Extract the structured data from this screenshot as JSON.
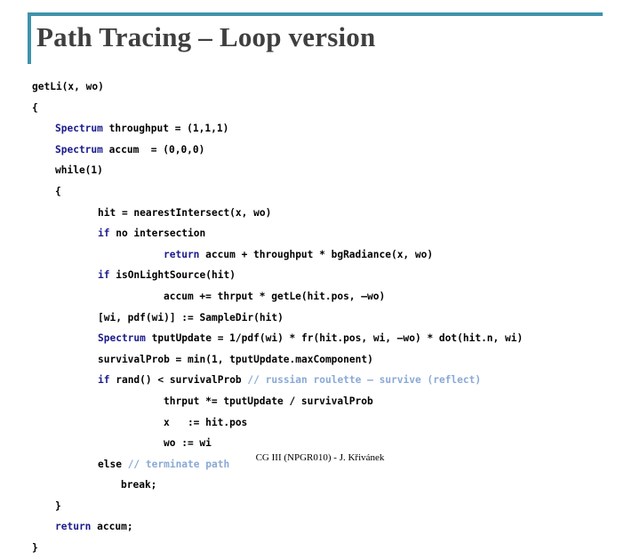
{
  "slide": {
    "accent_color": "#3f93ac",
    "title": "Path Tracing – Loop version",
    "footer": "CG III (NPGR010) - J. Křivánek"
  },
  "code": {
    "language": "pseudocode",
    "keyword_color": "#1a1a8c",
    "comment_color": "#8aa9d6",
    "text_color": "#000000",
    "lines": [
      {
        "indent": 0,
        "segments": [
          {
            "kind": "plain",
            "text": "getLi(x, wo)"
          }
        ]
      },
      {
        "indent": 0,
        "segments": [
          {
            "kind": "plain",
            "text": "{"
          }
        ]
      },
      {
        "indent": 1,
        "segments": [
          {
            "kind": "kw",
            "text": "Spectrum"
          },
          {
            "kind": "plain",
            "text": " throughput = (1,1,1)"
          }
        ]
      },
      {
        "indent": 1,
        "segments": [
          {
            "kind": "kw",
            "text": "Spectrum"
          },
          {
            "kind": "plain",
            "text": " accum  = (0,0,0)"
          }
        ]
      },
      {
        "indent": 1,
        "segments": [
          {
            "kind": "plain",
            "text": "while(1)"
          }
        ]
      },
      {
        "indent": 1,
        "segments": [
          {
            "kind": "plain",
            "text": "{"
          }
        ]
      },
      {
        "indent": 2,
        "segments": [
          {
            "kind": "plain",
            "text": "hit = nearestIntersect(x, wo)"
          }
        ]
      },
      {
        "indent": 2,
        "segments": [
          {
            "kind": "kw",
            "text": "if"
          },
          {
            "kind": "plain",
            "text": " no intersection"
          }
        ]
      },
      {
        "indent": 4,
        "segments": [
          {
            "kind": "kw",
            "text": "return"
          },
          {
            "kind": "plain",
            "text": " accum + throughput * bgRadiance(x, wo)"
          }
        ]
      },
      {
        "indent": 2,
        "segments": [
          {
            "kind": "kw",
            "text": "if"
          },
          {
            "kind": "plain",
            "text": " isOnLightSource(hit)"
          }
        ]
      },
      {
        "indent": 4,
        "segments": [
          {
            "kind": "plain",
            "text": "accum += thrput * getLe(hit.pos, –wo)"
          }
        ]
      },
      {
        "indent": 2,
        "segments": [
          {
            "kind": "plain",
            "text": "[wi, pdf(wi)] := SampleDir(hit)"
          }
        ]
      },
      {
        "indent": 2,
        "segments": [
          {
            "kind": "kw",
            "text": "Spectrum"
          },
          {
            "kind": "plain",
            "text": " tputUpdate = 1/pdf(wi) * fr(hit.pos, wi, –wo) * dot(hit.n, wi)"
          }
        ]
      },
      {
        "indent": 2,
        "segments": [
          {
            "kind": "plain",
            "text": "survivalProb = min(1, tputUpdate.maxComponent)"
          }
        ]
      },
      {
        "indent": 2,
        "segments": [
          {
            "kind": "kw",
            "text": "if"
          },
          {
            "kind": "plain",
            "text": " rand() < survivalProb "
          },
          {
            "kind": "comment",
            "text": "// russian roulette – survive (reflect)"
          }
        ]
      },
      {
        "indent": 4,
        "segments": [
          {
            "kind": "plain",
            "text": "thrput *= tputUpdate / survivalProb"
          }
        ]
      },
      {
        "indent": 4,
        "segments": [
          {
            "kind": "plain",
            "text": "x   := hit.pos"
          }
        ]
      },
      {
        "indent": 4,
        "segments": [
          {
            "kind": "plain",
            "text": "wo := wi"
          }
        ]
      },
      {
        "indent": 2,
        "segments": [
          {
            "kind": "plain",
            "text": "else "
          },
          {
            "kind": "comment",
            "text": "// terminate path"
          }
        ]
      },
      {
        "indent": 3,
        "segments": [
          {
            "kind": "plain",
            "text": "break;"
          }
        ]
      },
      {
        "indent": 1,
        "segments": [
          {
            "kind": "plain",
            "text": "}"
          }
        ]
      },
      {
        "indent": 1,
        "segments": [
          {
            "kind": "kw",
            "text": "return"
          },
          {
            "kind": "plain",
            "text": " accum;"
          }
        ]
      },
      {
        "indent": 0,
        "segments": [
          {
            "kind": "plain",
            "text": "}"
          }
        ]
      }
    ]
  }
}
